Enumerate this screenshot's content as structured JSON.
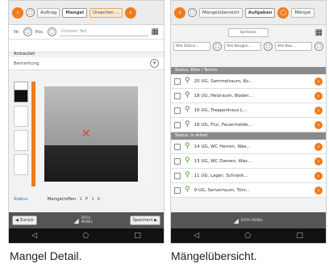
{
  "detail": {
    "tabs": [
      "Auftrag",
      "Mangel",
      "Ursachen ..."
    ],
    "field1": "Nr.",
    "field2": "Pos.",
    "field2_value": "Unterer Teil...",
    "title_value": "Anbauteil",
    "dropdown_value": "Bemerkung",
    "status_label": "Status",
    "status_value": "Mangel/offen",
    "qty": [
      "1",
      "P",
      "1",
      "b"
    ],
    "bottom_left": "Zurück",
    "bottom_right": "Speichern",
    "brand_line1": "DATA",
    "brand_line2": "MOBIL"
  },
  "overview": {
    "tabs": [
      "Mangelübersicht",
      "Aufgaben",
      "Mängel"
    ],
    "header": "Sortieren",
    "filters": [
      "Alle Status...",
      "Alle Bauges...",
      "Alle Bau..."
    ],
    "group1": "Status: Bitte / Termin",
    "group2": "Status: In Arbeit",
    "rows": [
      {
        "text": "20 UG, Sammelraum, Ko...",
        "pin": "gray"
      },
      {
        "text": "18 UG, Heizraum, Boden...",
        "pin": "gray"
      },
      {
        "text": "16 UG, Treppenhaus L...",
        "pin": "gray"
      },
      {
        "text": "16 UG, Flur, Feuermelde...",
        "pin": "gray"
      },
      {
        "text": "14 UG, WC Herren, Was...",
        "pin": "green"
      },
      {
        "text": "13 UG, WC Damen, Was...",
        "pin": "green"
      },
      {
        "text": "11 UG, Lager, Schrank...",
        "pin": "green"
      },
      {
        "text": "9 UG, Serverraum, Türs...",
        "pin": "green"
      }
    ],
    "bottom_brand": "DATA MOBIL"
  },
  "captions": {
    "left": "Mangel Detail.",
    "right": "Mängelübersicht."
  },
  "colors": {
    "accent": "#f07c1e",
    "pin_green": "#4aa02c",
    "pin_gray": "#666666"
  }
}
